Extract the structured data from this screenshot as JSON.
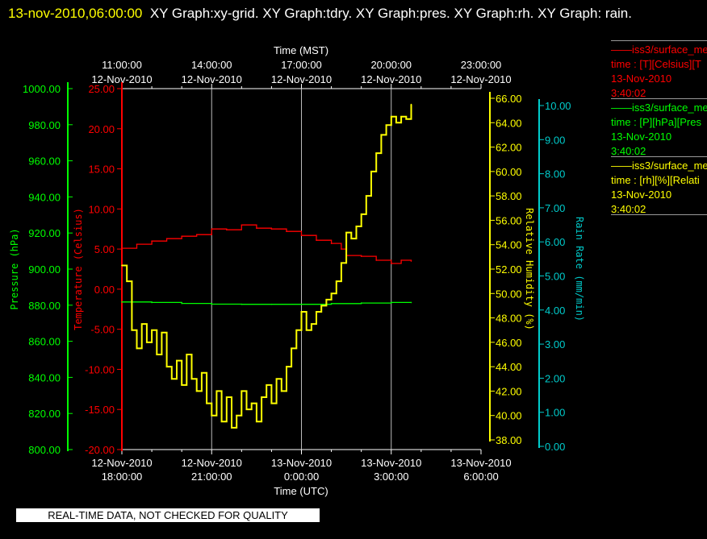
{
  "title": {
    "timestamp": "13-nov-2010,06:00:00",
    "text": "XY Graph:xy-grid.  XY Graph:tdry.  XY Graph:pres.  XY Graph:rh.  XY Graph: rain."
  },
  "legend": [
    {
      "line1": "iss3/surface_me",
      "line2": "time : [T][Celsius][T",
      "line3": "13-Nov-2010",
      "line4": "3:40:02",
      "color": "#ff0000"
    },
    {
      "line1": "iss3/surface_me",
      "line2": "time : [P][hPa][Pres",
      "line3": "13-Nov-2010",
      "line4": "3:40:02",
      "color": "#00ff00"
    },
    {
      "line1": "iss3/surface_me",
      "line2": "time : [rh][%][Relati",
      "line3": "13-Nov-2010",
      "line4": "3:40:02",
      "color": "#ffff00"
    }
  ],
  "banner": "REAL-TIME DATA, NOT CHECKED FOR QUALITY",
  "chart_data": {
    "type": "line",
    "grid": "vertical lines at major time ticks",
    "x_top": {
      "label": "Time (MST)",
      "ticks": [
        {
          "time": "11:00:00",
          "date": "12-Nov-2010"
        },
        {
          "time": "14:00:00",
          "date": "12-Nov-2010"
        },
        {
          "time": "17:00:00",
          "date": "12-Nov-2010"
        },
        {
          "time": "20:00:00",
          "date": "12-Nov-2010"
        },
        {
          "time": "23:00:00",
          "date": "12-Nov-2010"
        }
      ]
    },
    "x_bottom": {
      "label": "Time (UTC)",
      "range": [
        "2010-11-12T18:00",
        "2010-11-13T06:00"
      ],
      "ticks": [
        {
          "date": "12-Nov-2010",
          "time": "18:00:00",
          "value": "2010-11-12T18:00"
        },
        {
          "date": "12-Nov-2010",
          "time": "21:00:00",
          "value": "2010-11-12T21:00"
        },
        {
          "date": "13-Nov-2010",
          "time": "0:00:00",
          "value": "2010-11-13T00:00"
        },
        {
          "date": "13-Nov-2010",
          "time": "3:00:00",
          "value": "2010-11-13T03:00"
        },
        {
          "date": "13-Nov-2010",
          "time": "6:00:00",
          "value": "2010-11-13T06:00"
        }
      ]
    },
    "axes": {
      "pressure": {
        "label": "Pressure (hPa)",
        "color": "#00ff00",
        "range": [
          800,
          1000
        ],
        "ticks": [
          "1000.00",
          "980.00",
          "960.00",
          "940.00",
          "920.00",
          "900.00",
          "880.00",
          "860.00",
          "840.00",
          "820.00",
          "800.00"
        ]
      },
      "temperature": {
        "label": "Temperature (Celsius)",
        "color": "#ff0000",
        "range": [
          -20,
          25
        ],
        "ticks": [
          "25.00",
          "20.00",
          "15.00",
          "10.00",
          "5.00",
          "0.00",
          "-5.00",
          "-10.00",
          "-15.00",
          "-20.00"
        ]
      },
      "rh": {
        "label": "Relative Humidity (%)",
        "color": "#ffff00",
        "range": [
          38,
          66
        ],
        "ticks": [
          "66.00",
          "64.00",
          "62.00",
          "60.00",
          "58.00",
          "56.00",
          "54.00",
          "52.00",
          "50.00",
          "48.00",
          "46.00",
          "44.00",
          "42.00",
          "40.00",
          "38.00"
        ]
      },
      "rain": {
        "label": "Rain Rate (mm/min)",
        "color": "#00cccc",
        "range": [
          0,
          10
        ],
        "ticks": [
          "10.00",
          "9.00",
          "8.00",
          "7.00",
          "6.00",
          "5.00",
          "4.00",
          "3.00",
          "2.00",
          "1.00",
          "0.00"
        ]
      }
    },
    "series": [
      {
        "axis": "temperature",
        "color": "#ff0000",
        "x": [
          "2010-11-12T18:00",
          "2010-11-12T18:30",
          "2010-11-12T19:00",
          "2010-11-12T19:30",
          "2010-11-12T20:00",
          "2010-11-12T20:30",
          "2010-11-12T21:00",
          "2010-11-12T21:30",
          "2010-11-12T22:00",
          "2010-11-12T22:30",
          "2010-11-12T23:00",
          "2010-11-12T23:30",
          "2010-11-13T00:00",
          "2010-11-13T00:30",
          "2010-11-13T01:00",
          "2010-11-13T01:20",
          "2010-11-13T01:30",
          "2010-11-13T02:00",
          "2010-11-13T02:30",
          "2010-11-13T03:00",
          "2010-11-13T03:20",
          "2010-11-13T03:40"
        ],
        "y": [
          5.1,
          5.6,
          6.0,
          6.3,
          6.6,
          6.8,
          7.5,
          7.4,
          8.0,
          7.6,
          7.5,
          7.2,
          6.7,
          6.1,
          5.7,
          5.0,
          4.2,
          4.1,
          3.6,
          3.2,
          3.6,
          3.5
        ]
      },
      {
        "axis": "pressure",
        "color": "#00ff00",
        "x": [
          "2010-11-12T18:00",
          "2010-11-12T19:00",
          "2010-11-12T20:00",
          "2010-11-12T21:00",
          "2010-11-12T22:00",
          "2010-11-12T23:00",
          "2010-11-13T00:00",
          "2010-11-13T01:00",
          "2010-11-13T02:00",
          "2010-11-13T03:00",
          "2010-11-13T03:40"
        ],
        "y": [
          881.8,
          881.5,
          881.0,
          880.6,
          880.5,
          880.5,
          880.5,
          880.9,
          881.2,
          881.5,
          881.5
        ]
      },
      {
        "axis": "rh",
        "color": "#ffff00",
        "x": [
          "2010-11-12T18:00",
          "2010-11-12T18:10",
          "2010-11-12T18:20",
          "2010-11-12T18:30",
          "2010-11-12T18:40",
          "2010-11-12T18:50",
          "2010-11-12T19:00",
          "2010-11-12T19:10",
          "2010-11-12T19:20",
          "2010-11-12T19:30",
          "2010-11-12T19:40",
          "2010-11-12T19:50",
          "2010-11-12T20:00",
          "2010-11-12T20:10",
          "2010-11-12T20:20",
          "2010-11-12T20:30",
          "2010-11-12T20:40",
          "2010-11-12T20:50",
          "2010-11-12T21:00",
          "2010-11-12T21:10",
          "2010-11-12T21:20",
          "2010-11-12T21:30",
          "2010-11-12T21:40",
          "2010-11-12T21:50",
          "2010-11-12T22:00",
          "2010-11-12T22:10",
          "2010-11-12T22:20",
          "2010-11-12T22:30",
          "2010-11-12T22:40",
          "2010-11-12T22:50",
          "2010-11-12T23:00",
          "2010-11-12T23:10",
          "2010-11-12T23:20",
          "2010-11-12T23:30",
          "2010-11-12T23:40",
          "2010-11-12T23:50",
          "2010-11-13T00:00",
          "2010-11-13T00:10",
          "2010-11-13T00:20",
          "2010-11-13T00:30",
          "2010-11-13T00:40",
          "2010-11-13T00:50",
          "2010-11-13T01:00",
          "2010-11-13T01:10",
          "2010-11-13T01:20",
          "2010-11-13T01:30",
          "2010-11-13T01:40",
          "2010-11-13T01:50",
          "2010-11-13T02:00",
          "2010-11-13T02:10",
          "2010-11-13T02:20",
          "2010-11-13T02:30",
          "2010-11-13T02:40",
          "2010-11-13T02:50",
          "2010-11-13T03:00",
          "2010-11-13T03:10",
          "2010-11-13T03:20",
          "2010-11-13T03:30",
          "2010-11-13T03:40"
        ],
        "y": [
          52.3,
          51.0,
          47.0,
          45.5,
          47.5,
          46.0,
          47.0,
          45.0,
          46.8,
          44.0,
          43.0,
          44.5,
          42.5,
          45.0,
          43.0,
          42.0,
          43.5,
          41.0,
          40.0,
          42.0,
          39.5,
          41.5,
          39.0,
          40.0,
          42.0,
          40.5,
          41.0,
          39.5,
          41.5,
          42.5,
          41.0,
          43.0,
          42.0,
          44.0,
          45.5,
          47.0,
          48.5,
          47.0,
          47.5,
          48.5,
          49.0,
          49.5,
          50.0,
          51.0,
          52.5,
          55.0,
          54.5,
          55.5,
          56.5,
          58.0,
          60.0,
          61.5,
          63.0,
          63.8,
          64.5,
          64.0,
          64.5,
          64.3,
          65.5
        ]
      }
    ]
  }
}
